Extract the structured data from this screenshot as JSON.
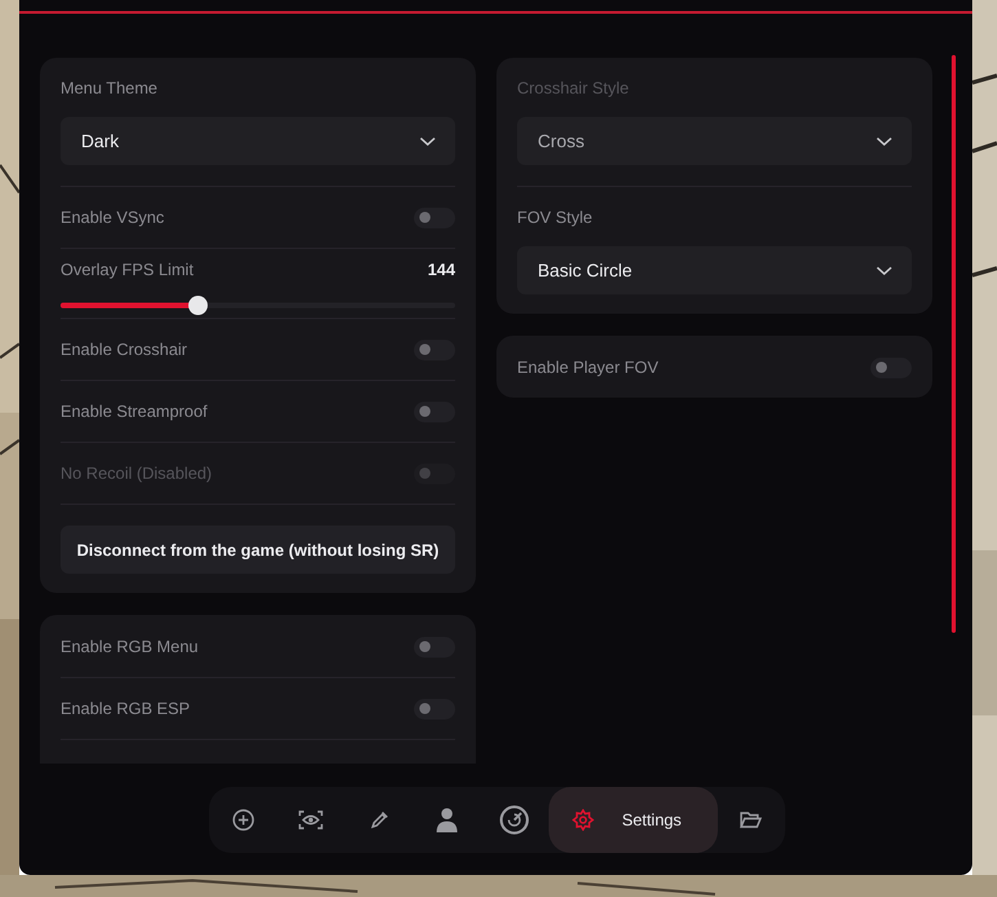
{
  "left_panel": {
    "theme_label": "Menu Theme",
    "theme_value": "Dark",
    "settings": [
      {
        "kind": "toggle",
        "label": "Enable VSync",
        "on": false,
        "disabled": false
      },
      {
        "kind": "slider",
        "label": "Overlay FPS Limit",
        "reading": "144",
        "level": 0.35
      },
      {
        "kind": "toggle",
        "label": "Enable Crosshair",
        "on": false,
        "disabled": false
      },
      {
        "kind": "toggle",
        "label": "Enable Streamproof",
        "on": false,
        "disabled": false
      },
      {
        "kind": "toggle",
        "label": "No Recoil (Disabled)",
        "on": false,
        "disabled": true
      }
    ],
    "button": "Disconnect from the game (without losing SR)"
  },
  "rgb_panel": {
    "toggles": [
      {
        "label": "Enable RGB Menu",
        "on": false
      },
      {
        "label": "Enable RGB ESP",
        "on": false
      }
    ]
  },
  "right_panel": {
    "selects": [
      {
        "label": "Crosshair Style",
        "value": "Cross",
        "disabled": true
      },
      {
        "label": "FOV Style",
        "value": "Basic Circle",
        "disabled": false
      }
    ]
  },
  "player_fov": {
    "label": "Enable Player FOV",
    "on": false
  },
  "nav": [
    {
      "kind": "crosshair",
      "selected": false
    },
    {
      "kind": "eye",
      "selected": false
    },
    {
      "kind": "dropper",
      "selected": false
    },
    {
      "kind": "person",
      "selected": false
    },
    {
      "kind": "gauge",
      "selected": false
    },
    {
      "kind": "gear",
      "label": "Settings",
      "selected": true
    },
    {
      "kind": "folder",
      "selected": false
    }
  ]
}
